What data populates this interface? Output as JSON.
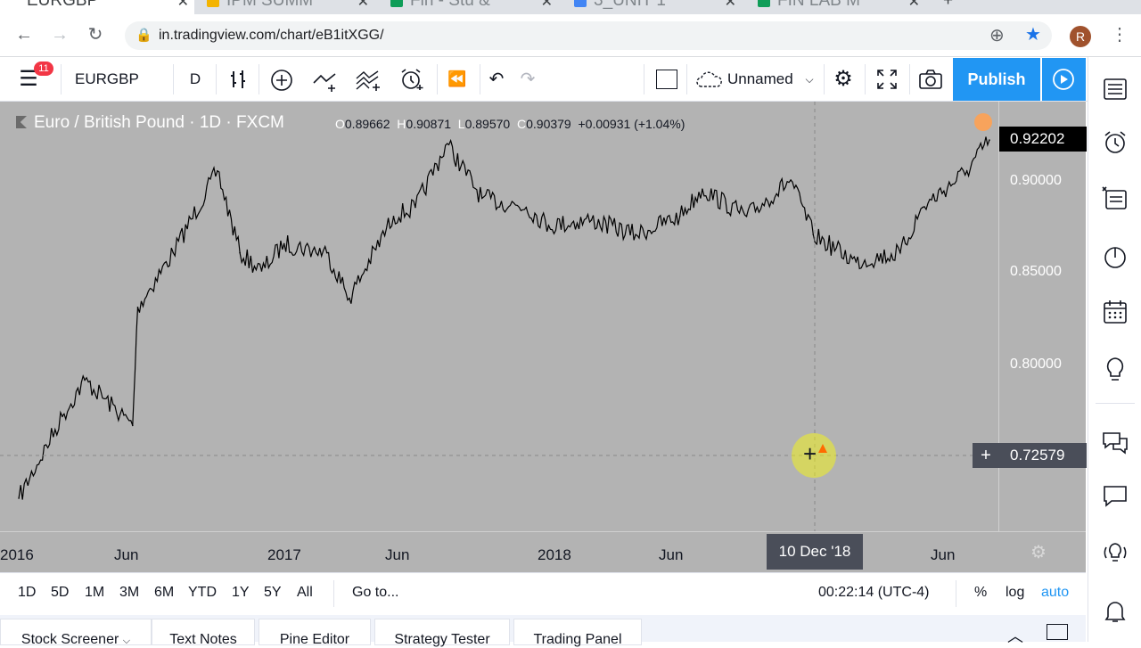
{
  "browser": {
    "tabs": [
      {
        "label": "EURGBP",
        "color": "#2962ff",
        "active": true
      },
      {
        "label": "IPM SUMM",
        "color": "#f4b400",
        "active": false
      },
      {
        "label": "Fin - Stu &",
        "color": "#0f9d58",
        "active": false
      },
      {
        "label": "3_UNIT 1",
        "color": "#4285f4",
        "active": false
      },
      {
        "label": "FIN LAB M",
        "color": "#0f9d58",
        "active": false
      }
    ],
    "new_tab": "+",
    "url": "in.tradingview.com/chart/eB1itXGG/",
    "profile_initial": "R"
  },
  "toolbar": {
    "notif_count": "11",
    "symbol": "EURGBP",
    "interval": "D",
    "layout_name": "Unnamed",
    "publish_label": "Publish"
  },
  "legend": {
    "title": "Euro / British Pound · 1D · FXCM",
    "o_label": "O",
    "o_value": "0.89662",
    "h_label": "H",
    "h_value": "0.90871",
    "l_label": "L",
    "l_value": "0.89570",
    "c_label": "C",
    "c_value": "0.90379",
    "change": "+0.00931 (+1.04%)"
  },
  "price_axis": {
    "ticks": [
      "0.90000",
      "0.85000",
      "0.80000"
    ],
    "last_price": "0.92202",
    "cursor_price": "0.72579"
  },
  "time_axis": {
    "ticks": [
      "2016",
      "Jun",
      "2017",
      "Jun",
      "2018",
      "Jun",
      "Jun"
    ],
    "cursor_date": "10 Dec '18"
  },
  "bottom_bar": {
    "ranges": [
      "1D",
      "5D",
      "1M",
      "3M",
      "6M",
      "YTD",
      "1Y",
      "5Y",
      "All"
    ],
    "goto": "Go to...",
    "clock": "00:22:14 (UTC-4)",
    "pct": "%",
    "log": "log",
    "auto": "auto"
  },
  "panels": [
    "Stock Screener",
    "Text Notes",
    "Pine Editor",
    "Strategy Tester",
    "Trading Panel"
  ],
  "chart_data": {
    "type": "line",
    "title": "Euro / British Pound · 1D · FXCM",
    "xlabel": "",
    "ylabel": "",
    "x": [
      "2016-01",
      "2016-03",
      "2016-04",
      "2016-06-20",
      "2016-06-27",
      "2016-08",
      "2016-10",
      "2016-11",
      "2016-12",
      "2017-01",
      "2017-03",
      "2017-04",
      "2017-06",
      "2017-07",
      "2017-08-28",
      "2017-10",
      "2017-12",
      "2018-01",
      "2018-03",
      "2018-05",
      "2018-07",
      "2018-08",
      "2018-10",
      "2018-12",
      "2019-01",
      "2019-03",
      "2019-05",
      "2019-06",
      "2019-08",
      "2019-09"
    ],
    "series": [
      {
        "values": [
          0.725,
          0.77,
          0.79,
          0.765,
          0.83,
          0.86,
          0.905,
          0.86,
          0.85,
          0.865,
          0.86,
          0.835,
          0.88,
          0.885,
          0.92,
          0.89,
          0.885,
          0.875,
          0.878,
          0.87,
          0.88,
          0.895,
          0.88,
          0.9,
          0.87,
          0.855,
          0.86,
          0.885,
          0.905,
          0.922
        ]
      }
    ],
    "ylim": [
      0.7,
      0.94
    ],
    "grid": false,
    "cursor": {
      "date": "10 Dec '18",
      "price": "0.72579"
    }
  }
}
